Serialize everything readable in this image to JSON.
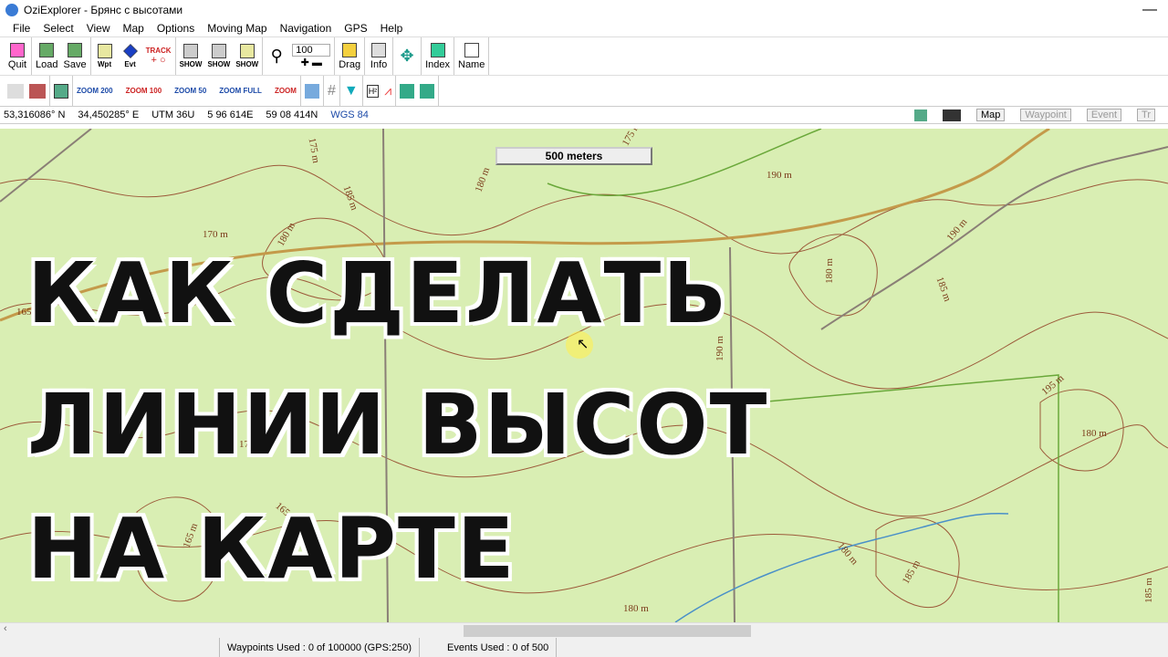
{
  "window": {
    "title": "OziExplorer - Брянс с высотами",
    "minimize": "—"
  },
  "menu": [
    "File",
    "Select",
    "View",
    "Map",
    "Options",
    "Moving Map",
    "Navigation",
    "GPS",
    "Help"
  ],
  "toolbar1": {
    "quit": "Quit",
    "load": "Load",
    "save": "Save",
    "wpt": "Wpt",
    "evt": "Evt",
    "track": "TRACK",
    "show": "SHOW",
    "zoom_value": "100",
    "drag": "Drag",
    "info": "Info",
    "index": "Index",
    "name": "Name"
  },
  "toolbar2": {
    "zoom200": "ZOOM 200",
    "zoom100": "ZOOM 100",
    "zoom50": "ZOOM 50",
    "zoomfull": "ZOOM FULL",
    "zoomsel": "ZOOM"
  },
  "coords": {
    "lat": "53,316086° N",
    "lon": "34,450285° E",
    "utm": "UTM  36U",
    "east": "5 96 614E",
    "north": "59 08 414N",
    "datum": "WGS 84"
  },
  "coord_tabs": [
    "Map",
    "Waypoint",
    "Event",
    "Tr"
  ],
  "map": {
    "scale": "500 meters",
    "elevations": [
      "175 m",
      "185 m",
      "180 m",
      "170 m",
      "180 m",
      "175 m",
      "190 m",
      "190 m",
      "180 m",
      "185 m",
      "190 m",
      "195 m",
      "180 m",
      "165 m",
      "165 m",
      "180 m",
      "185 m",
      "180 m",
      "185 m",
      "165",
      "17"
    ]
  },
  "overlay": [
    "КАК СДЕЛАТЬ",
    "ЛИНИИ ВЫСОТ",
    "НА КАРТЕ"
  ],
  "status": {
    "waypoints": "Waypoints Used : 0 of 100000  (GPS:250)",
    "events": "Events Used : 0 of 500"
  }
}
